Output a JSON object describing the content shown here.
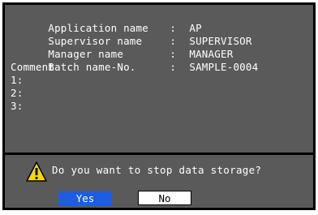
{
  "info": {
    "application": {
      "label": "Application name",
      "sep": ":",
      "value": "AP"
    },
    "supervisor": {
      "label": "Supervisor name",
      "sep": ":",
      "value": "SUPERVISOR"
    },
    "manager": {
      "label": "Manager name",
      "sep": ":",
      "value": "MANAGER"
    },
    "batch": {
      "label": "Batch name-No.",
      "sep": ":",
      "value": "SAMPLE-0004"
    },
    "comment": {
      "label": "Comment",
      "lines": [
        "1:",
        "2:",
        "3:"
      ]
    }
  },
  "prompt": {
    "icon": "warning-triangle-icon",
    "text": "Do you want to stop data storage?"
  },
  "buttons": {
    "yes": "Yes",
    "no": "No"
  },
  "colors": {
    "panel": "#5a5a5a",
    "frame": "#000000",
    "text": "#ffffff",
    "selected_button": "#1e5dde",
    "warning": "#f5d800"
  }
}
